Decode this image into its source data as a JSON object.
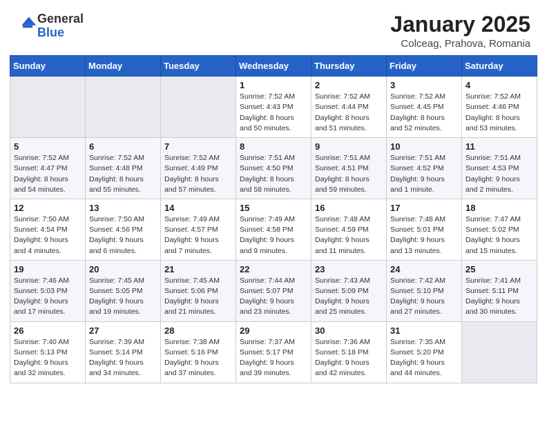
{
  "header": {
    "logo_general": "General",
    "logo_blue": "Blue",
    "title": "January 2025",
    "subtitle": "Colceag, Prahova, Romania"
  },
  "days_of_week": [
    "Sunday",
    "Monday",
    "Tuesday",
    "Wednesday",
    "Thursday",
    "Friday",
    "Saturday"
  ],
  "weeks": [
    [
      {
        "day": "",
        "info": ""
      },
      {
        "day": "",
        "info": ""
      },
      {
        "day": "",
        "info": ""
      },
      {
        "day": "1",
        "info": "Sunrise: 7:52 AM\nSunset: 4:43 PM\nDaylight: 8 hours\nand 50 minutes."
      },
      {
        "day": "2",
        "info": "Sunrise: 7:52 AM\nSunset: 4:44 PM\nDaylight: 8 hours\nand 51 minutes."
      },
      {
        "day": "3",
        "info": "Sunrise: 7:52 AM\nSunset: 4:45 PM\nDaylight: 8 hours\nand 52 minutes."
      },
      {
        "day": "4",
        "info": "Sunrise: 7:52 AM\nSunset: 4:46 PM\nDaylight: 8 hours\nand 53 minutes."
      }
    ],
    [
      {
        "day": "5",
        "info": "Sunrise: 7:52 AM\nSunset: 4:47 PM\nDaylight: 8 hours\nand 54 minutes."
      },
      {
        "day": "6",
        "info": "Sunrise: 7:52 AM\nSunset: 4:48 PM\nDaylight: 8 hours\nand 55 minutes."
      },
      {
        "day": "7",
        "info": "Sunrise: 7:52 AM\nSunset: 4:49 PM\nDaylight: 8 hours\nand 57 minutes."
      },
      {
        "day": "8",
        "info": "Sunrise: 7:51 AM\nSunset: 4:50 PM\nDaylight: 8 hours\nand 58 minutes."
      },
      {
        "day": "9",
        "info": "Sunrise: 7:51 AM\nSunset: 4:51 PM\nDaylight: 8 hours\nand 59 minutes."
      },
      {
        "day": "10",
        "info": "Sunrise: 7:51 AM\nSunset: 4:52 PM\nDaylight: 9 hours\nand 1 minute."
      },
      {
        "day": "11",
        "info": "Sunrise: 7:51 AM\nSunset: 4:53 PM\nDaylight: 9 hours\nand 2 minutes."
      }
    ],
    [
      {
        "day": "12",
        "info": "Sunrise: 7:50 AM\nSunset: 4:54 PM\nDaylight: 9 hours\nand 4 minutes."
      },
      {
        "day": "13",
        "info": "Sunrise: 7:50 AM\nSunset: 4:56 PM\nDaylight: 9 hours\nand 6 minutes."
      },
      {
        "day": "14",
        "info": "Sunrise: 7:49 AM\nSunset: 4:57 PM\nDaylight: 9 hours\nand 7 minutes."
      },
      {
        "day": "15",
        "info": "Sunrise: 7:49 AM\nSunset: 4:58 PM\nDaylight: 9 hours\nand 9 minutes."
      },
      {
        "day": "16",
        "info": "Sunrise: 7:48 AM\nSunset: 4:59 PM\nDaylight: 9 hours\nand 11 minutes."
      },
      {
        "day": "17",
        "info": "Sunrise: 7:48 AM\nSunset: 5:01 PM\nDaylight: 9 hours\nand 13 minutes."
      },
      {
        "day": "18",
        "info": "Sunrise: 7:47 AM\nSunset: 5:02 PM\nDaylight: 9 hours\nand 15 minutes."
      }
    ],
    [
      {
        "day": "19",
        "info": "Sunrise: 7:46 AM\nSunset: 5:03 PM\nDaylight: 9 hours\nand 17 minutes."
      },
      {
        "day": "20",
        "info": "Sunrise: 7:45 AM\nSunset: 5:05 PM\nDaylight: 9 hours\nand 19 minutes."
      },
      {
        "day": "21",
        "info": "Sunrise: 7:45 AM\nSunset: 5:06 PM\nDaylight: 9 hours\nand 21 minutes."
      },
      {
        "day": "22",
        "info": "Sunrise: 7:44 AM\nSunset: 5:07 PM\nDaylight: 9 hours\nand 23 minutes."
      },
      {
        "day": "23",
        "info": "Sunrise: 7:43 AM\nSunset: 5:09 PM\nDaylight: 9 hours\nand 25 minutes."
      },
      {
        "day": "24",
        "info": "Sunrise: 7:42 AM\nSunset: 5:10 PM\nDaylight: 9 hours\nand 27 minutes."
      },
      {
        "day": "25",
        "info": "Sunrise: 7:41 AM\nSunset: 5:11 PM\nDaylight: 9 hours\nand 30 minutes."
      }
    ],
    [
      {
        "day": "26",
        "info": "Sunrise: 7:40 AM\nSunset: 5:13 PM\nDaylight: 9 hours\nand 32 minutes."
      },
      {
        "day": "27",
        "info": "Sunrise: 7:39 AM\nSunset: 5:14 PM\nDaylight: 9 hours\nand 34 minutes."
      },
      {
        "day": "28",
        "info": "Sunrise: 7:38 AM\nSunset: 5:16 PM\nDaylight: 9 hours\nand 37 minutes."
      },
      {
        "day": "29",
        "info": "Sunrise: 7:37 AM\nSunset: 5:17 PM\nDaylight: 9 hours\nand 39 minutes."
      },
      {
        "day": "30",
        "info": "Sunrise: 7:36 AM\nSunset: 5:18 PM\nDaylight: 9 hours\nand 42 minutes."
      },
      {
        "day": "31",
        "info": "Sunrise: 7:35 AM\nSunset: 5:20 PM\nDaylight: 9 hours\nand 44 minutes."
      },
      {
        "day": "",
        "info": ""
      }
    ]
  ]
}
